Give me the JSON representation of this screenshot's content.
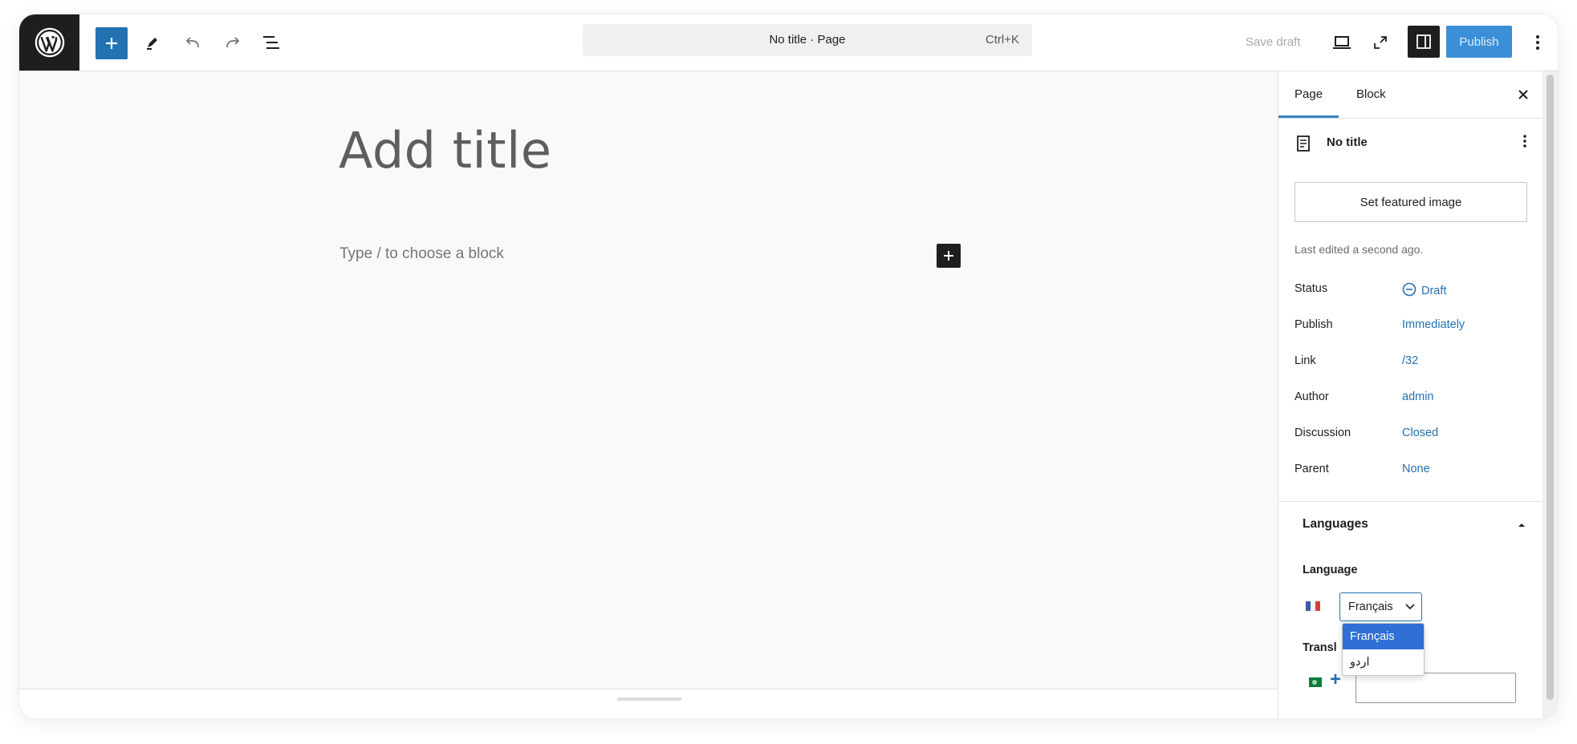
{
  "toolbar": {
    "add_block_icon": "plus-icon",
    "tools_icon": "pencil-icon",
    "undo_icon": "undo-icon",
    "redo_icon": "redo-icon",
    "list_view_icon": "list-view-icon",
    "command_title": "No title · Page",
    "command_shortcut": "Ctrl+K",
    "save_draft": "Save draft",
    "publish": "Publish"
  },
  "editor": {
    "title_placeholder": "Add title",
    "block_placeholder": "Type / to choose a block"
  },
  "sidebar": {
    "tabs": [
      "Page",
      "Block"
    ],
    "doc_title": "No title",
    "featured_image": "Set featured image",
    "last_edited": "Last edited a second ago.",
    "properties": [
      {
        "label": "Status",
        "value": "Draft"
      },
      {
        "label": "Publish",
        "value": "Immediately"
      },
      {
        "label": "Link",
        "value": "/32"
      },
      {
        "label": "Author",
        "value": "admin"
      },
      {
        "label": "Discussion",
        "value": "Closed"
      },
      {
        "label": "Parent",
        "value": "None"
      }
    ],
    "languages": {
      "heading": "Languages",
      "language_label": "Language",
      "selected": "Français",
      "options": [
        "Français",
        "اردو"
      ],
      "translations_label": "Transl"
    }
  },
  "colors": {
    "accent": "#2271b1",
    "dark": "#1e1e1e",
    "selection": "#2f6fd6"
  }
}
